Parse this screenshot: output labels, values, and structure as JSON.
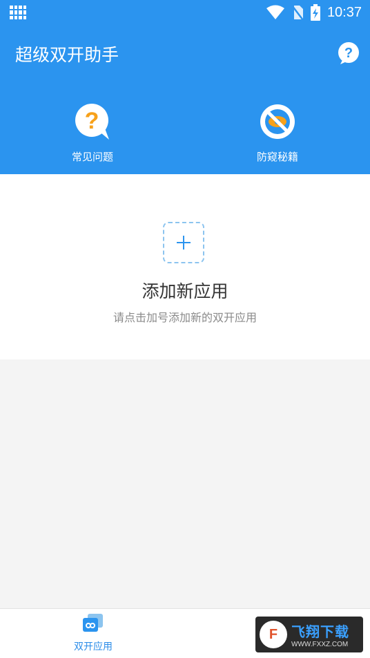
{
  "status_bar": {
    "time": "10:37"
  },
  "app_bar": {
    "title": "超级双开助手"
  },
  "features": [
    {
      "label": "常见问题",
      "icon": "question-bubble-icon"
    },
    {
      "label": "防窥秘籍",
      "icon": "eye-slash-icon"
    }
  ],
  "add_app": {
    "title": "添加新应用",
    "subtitle": "请点击加号添加新的双开应用"
  },
  "bottom_nav": [
    {
      "label": "双开应用",
      "icon": "dual-app-icon",
      "active": true
    }
  ],
  "watermark": {
    "brand": "飞翔下载",
    "url": "WWW.FXXZ.COM"
  },
  "colors": {
    "primary": "#2b94ef",
    "accent_orange": "#f7a11a",
    "active_nav": "#2b8ce8"
  }
}
